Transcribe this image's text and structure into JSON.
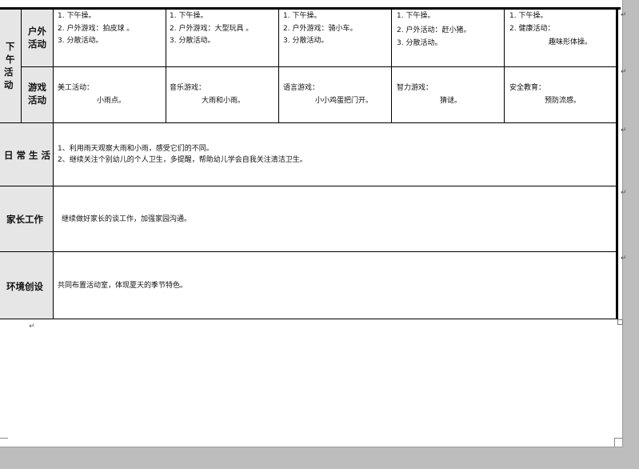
{
  "afternoon": {
    "section_label": [
      "下",
      "午",
      "活",
      "动"
    ],
    "outdoor": {
      "label_line1": "户外",
      "label_line2": "活动",
      "days": [
        [
          "1. 下午操。",
          "2. 户外游戏：拍皮球 。",
          "3. 分散活动。"
        ],
        [
          "1. 下午操。",
          "2. 户外游戏：大型玩具 。",
          "3. 分散活动。"
        ],
        [
          "1. 下午操。",
          "2. 户外游戏：骑小车。",
          "3. 分散活动。"
        ],
        [
          "1. 下午操。",
          "2. 户外活动：赶小猪。",
          "3. 分散活动。"
        ],
        [
          "1. 下午操。",
          "2. 健康活动：",
          "趣味形体操。"
        ]
      ]
    },
    "games": {
      "label_line1": "游戏",
      "label_line2": "活动",
      "days": [
        [
          "美工活动：",
          "小雨点。"
        ],
        [
          "音乐游戏：",
          "大雨和小雨。"
        ],
        [
          "语言游戏：",
          "小小鸡蛋把门开。"
        ],
        [
          "智力游戏：",
          "猜谜。"
        ],
        [
          "安全教育：",
          "预防流感。"
        ]
      ]
    }
  },
  "daily_life": {
    "label": "日 常 生 活",
    "lines": [
      "1、利用雨天观察大雨和小雨，感受它们的不同。",
      "2、继续关注个别幼儿的个人卫生，多提醒，帮助幼儿学会自我关注清洁卫生。"
    ]
  },
  "parents": {
    "label": "家长工作",
    "text": "继续做好家长的谈工作，加强家园沟通。"
  },
  "environment": {
    "label": "环境创设",
    "text": "共同布置活动室，体现夏天的季节特色。"
  },
  "marks": {
    "return": "↵",
    "para_end": "。"
  }
}
